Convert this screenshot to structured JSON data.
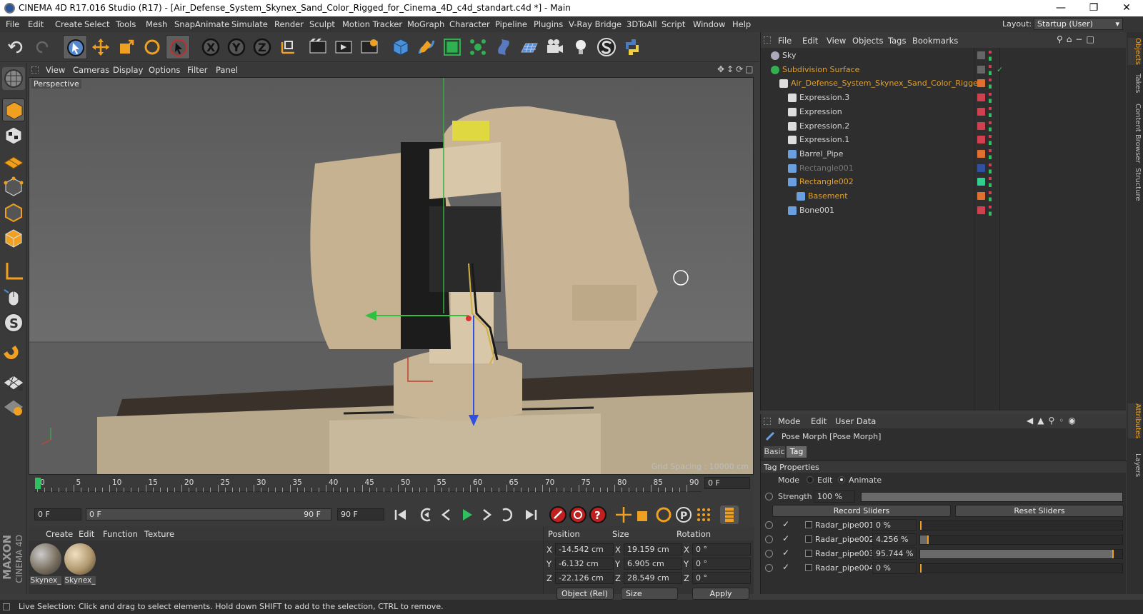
{
  "window": {
    "title": "CINEMA 4D R17.016 Studio (R17) - [Air_Defense_System_Skynex_Sand_Color_Rigged_for_Cinema_4D_c4d_standart.c4d *] - Main"
  },
  "menu": [
    "File",
    "Edit",
    "Create",
    "Select",
    "Tools",
    "Mesh",
    "Snap",
    "Animate",
    "Simulate",
    "Render",
    "Sculpt",
    "Motion Tracker",
    "MoGraph",
    "Character",
    "Pipeline",
    "Plugins",
    "V-Ray Bridge",
    "3DToAll",
    "Script",
    "Window",
    "Help"
  ],
  "layout": {
    "label": "Layout:",
    "value": "Startup (User)"
  },
  "viewport": {
    "menu": [
      "View",
      "Cameras",
      "Display",
      "Options",
      "Filter",
      "Panel"
    ],
    "label": "Perspective",
    "grid_spacing": "Grid Spacing : 10000 cm"
  },
  "timeline": {
    "ticks": [
      "0",
      "5",
      "10",
      "15",
      "20",
      "25",
      "30",
      "35",
      "40",
      "45",
      "50",
      "55",
      "60",
      "65",
      "70",
      "75",
      "80",
      "85",
      "90"
    ],
    "current_frame_field": "0 F",
    "start_field": "0 F",
    "range_left": "0 F",
    "range_right": "90 F",
    "end_field": "90 F",
    "end_field2": "90 F"
  },
  "materials": {
    "menu": [
      "Create",
      "Edit",
      "Function",
      "Texture"
    ],
    "items": [
      "Skynex_",
      "Skynex_"
    ]
  },
  "coords": {
    "headers": [
      "Position",
      "Size",
      "Rotation"
    ],
    "rows": [
      {
        "axis": "X",
        "pos": "-14.542 cm",
        "saxis": "X",
        "size": "19.159 cm",
        "raxis": "X",
        "rot": "0 °"
      },
      {
        "axis": "Y",
        "pos": "-6.132 cm",
        "saxis": "Y",
        "size": "6.905 cm",
        "raxis": "Y",
        "rot": "0 °"
      },
      {
        "axis": "Z",
        "pos": "-22.126 cm",
        "saxis": "Z",
        "size": "28.549 cm",
        "raxis": "Z",
        "rot": "0 °"
      }
    ],
    "mode": "Object (Rel)",
    "size_mode": "Size",
    "apply": "Apply"
  },
  "maxon": {
    "line1": "MAXON",
    "line2": "CINEMA 4D"
  },
  "status": "Live Selection: Click and drag to select elements. Hold down SHIFT to add to the selection, CTRL to remove.",
  "objects": {
    "menu": [
      "File",
      "Edit",
      "View",
      "Objects",
      "Tags",
      "Bookmarks"
    ],
    "rows": [
      {
        "name": "Sky",
        "indent": 0,
        "color": "#d4d4d4",
        "vis": "#666"
      },
      {
        "name": "Subdivision Surface",
        "indent": 0,
        "color": "#e0a030",
        "vis": "#666"
      },
      {
        "name": "Air_Defense_System_Skynex_Sand_Color_Rigged",
        "indent": 1,
        "color": "#e0a030",
        "vis": "#e07030"
      },
      {
        "name": "Expression.3",
        "indent": 2,
        "color": "#d4d4d4",
        "vis": "#d04050"
      },
      {
        "name": "Expression",
        "indent": 2,
        "color": "#d4d4d4",
        "vis": "#d04050"
      },
      {
        "name": "Expression.2",
        "indent": 2,
        "color": "#d4d4d4",
        "vis": "#d04050"
      },
      {
        "name": "Expression.1",
        "indent": 2,
        "color": "#d4d4d4",
        "vis": "#d04050"
      },
      {
        "name": "Barrel_Pipe",
        "indent": 2,
        "color": "#d4d4d4",
        "vis": "#e07030"
      },
      {
        "name": "Rectangle001",
        "indent": 2,
        "color": "#777777",
        "vis": "#3050a0"
      },
      {
        "name": "Rectangle002",
        "indent": 2,
        "color": "#e0a030",
        "vis": "#30d090"
      },
      {
        "name": "Basement",
        "indent": 3,
        "color": "#e0a030",
        "vis": "#e07030"
      },
      {
        "name": "Bone001",
        "indent": 2,
        "color": "#d4d4d4",
        "vis": "#d04050"
      }
    ]
  },
  "attributes": {
    "menu": [
      "Mode",
      "Edit",
      "User Data"
    ],
    "title": "Pose Morph [Pose Morph]",
    "tabs": [
      "Basic",
      "Tag"
    ],
    "section": "Tag Properties",
    "mode_label": "Mode",
    "mode_opts": [
      "Edit",
      "Animate"
    ],
    "strength_label": "Strength",
    "strength_value": "100 %",
    "strength": 1.0,
    "record": "Record Sliders",
    "reset": "Reset Sliders",
    "sliders": [
      {
        "name": "Radar_pipe001",
        "value": "0 %",
        "fill": 0.0
      },
      {
        "name": "Radar_pipe002",
        "value": "4.256 %",
        "fill": 0.04256
      },
      {
        "name": "Radar_pipe003",
        "value": "95.744 %",
        "fill": 0.95744
      },
      {
        "name": "Radar_pipe004",
        "value": "0 %",
        "fill": 0.0
      }
    ]
  },
  "side_tabs": [
    "Objects",
    "Takes",
    "Content Browser",
    "Structure",
    "Attributes",
    "Layers"
  ]
}
